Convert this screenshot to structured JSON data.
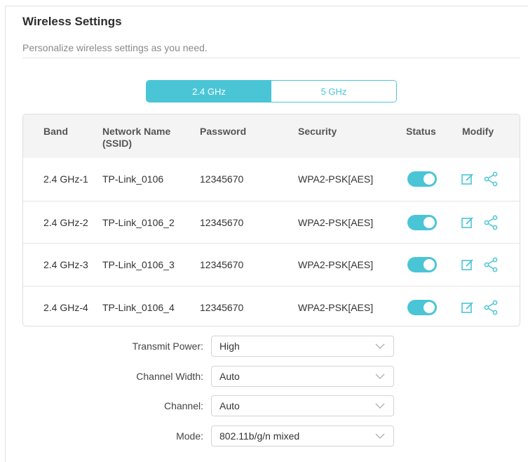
{
  "page": {
    "title": "Wireless Settings",
    "subtitle": "Personalize wireless settings as you need."
  },
  "band_tabs": [
    {
      "label": "2.4 GHz",
      "active": true
    },
    {
      "label": "5 GHz",
      "active": false
    }
  ],
  "table": {
    "headers": {
      "band": "Band",
      "network_name_line1": "Network Name",
      "network_name_line2": "(SSID)",
      "password": "Password",
      "security": "Security",
      "status": "Status",
      "modify": "Modify"
    },
    "rows": [
      {
        "band": "2.4 GHz-1",
        "ssid": "TP-Link_0106",
        "password": "12345670",
        "security": "WPA2-PSK[AES]",
        "status_on": true
      },
      {
        "band": "2.4 GHz-2",
        "ssid": "TP-Link_0106_2",
        "password": "12345670",
        "security": "WPA2-PSK[AES]",
        "status_on": true
      },
      {
        "band": "2.4 GHz-3",
        "ssid": "TP-Link_0106_3",
        "password": "12345670",
        "security": "WPA2-PSK[AES]",
        "status_on": true
      },
      {
        "band": "2.4 GHz-4",
        "ssid": "TP-Link_0106_4",
        "password": "12345670",
        "security": "WPA2-PSK[AES]",
        "status_on": true
      }
    ]
  },
  "form": {
    "transmit_power": {
      "label": "Transmit Power:",
      "value": "High"
    },
    "channel_width": {
      "label": "Channel Width:",
      "value": "Auto"
    },
    "channel": {
      "label": "Channel:",
      "value": "Auto"
    },
    "mode": {
      "label": "Mode:",
      "value": "802.11b/g/n mixed"
    }
  },
  "icons": {
    "edit": "edit-icon",
    "share": "share-icon",
    "dropdown": "chevron-down-icon"
  },
  "colors": {
    "accent": "#4ac5d6",
    "header_bg": "#f4f4f4"
  }
}
